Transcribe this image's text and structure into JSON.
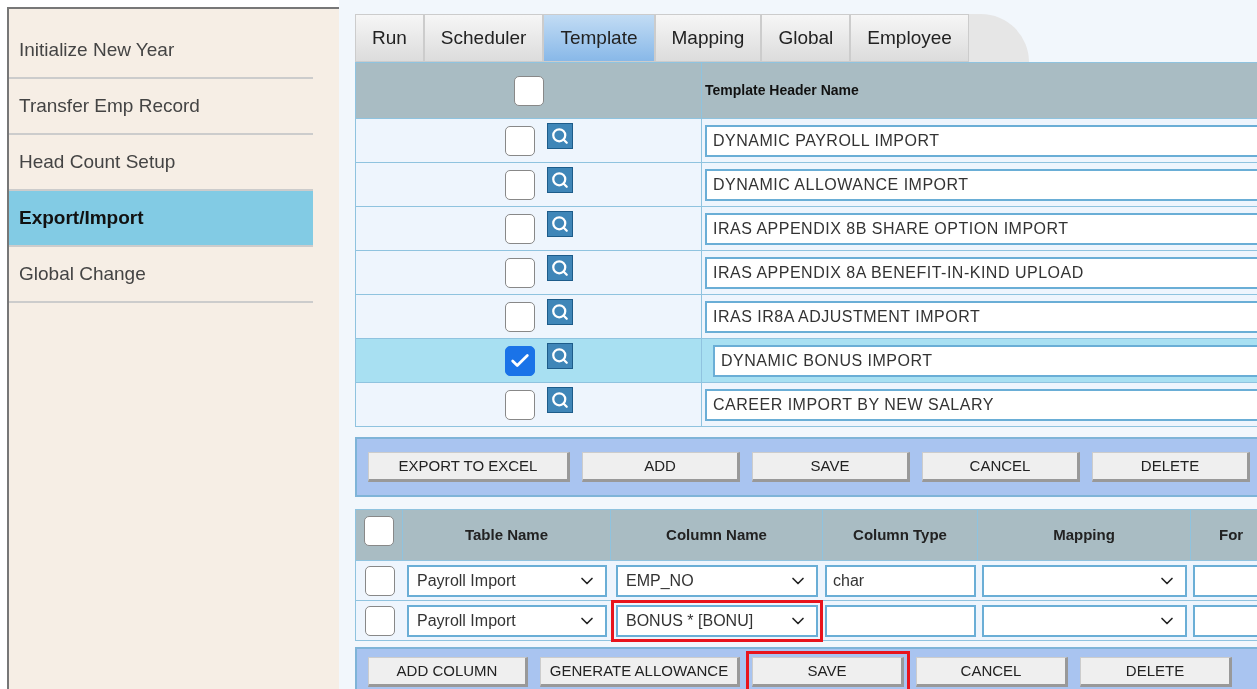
{
  "sidebar": {
    "items": [
      {
        "label": "Initialize New Year",
        "selected": false
      },
      {
        "label": "Transfer Emp Record",
        "selected": false
      },
      {
        "label": "Head Count Setup",
        "selected": false
      },
      {
        "label": "Export/Import",
        "selected": true
      },
      {
        "label": "Global Change",
        "selected": false
      }
    ]
  },
  "tabs": [
    {
      "label": "Run",
      "selected": false
    },
    {
      "label": "Scheduler",
      "selected": false
    },
    {
      "label": "Template",
      "selected": true
    },
    {
      "label": "Mapping",
      "selected": false
    },
    {
      "label": "Global",
      "selected": false
    },
    {
      "label": "Employee",
      "selected": false
    }
  ],
  "templates": {
    "header_checked": false,
    "column": "Template Header Name",
    "rows": [
      {
        "name": "DYNAMIC PAYROLL IMPORT",
        "checked": false
      },
      {
        "name": "DYNAMIC ALLOWANCE IMPORT",
        "checked": false
      },
      {
        "name": "IRAS APPENDIX 8B SHARE OPTION IMPORT",
        "checked": false
      },
      {
        "name": "IRAS APPENDIX 8A BENEFIT-IN-KIND UPLOAD",
        "checked": false
      },
      {
        "name": "IRAS IR8A ADJUSTMENT IMPORT",
        "checked": false
      },
      {
        "name": "DYNAMIC BONUS IMPORT",
        "checked": true
      },
      {
        "name": "CAREER IMPORT BY NEW SALARY",
        "checked": false
      }
    ]
  },
  "template_buttons": [
    {
      "label": "EXPORT TO EXCEL",
      "highlighted": false
    },
    {
      "label": "ADD",
      "highlighted": false
    },
    {
      "label": "SAVE",
      "highlighted": false
    },
    {
      "label": "CANCEL",
      "highlighted": false
    },
    {
      "label": "DELETE",
      "highlighted": false
    }
  ],
  "columns_table": {
    "header_checked": false,
    "columns": [
      "Table Name",
      "Column Name",
      "Column Type",
      "Mapping",
      "For"
    ],
    "rows": [
      {
        "checked": false,
        "table_name": "Payroll Import",
        "column_name": {
          "value": "EMP_NO",
          "highlighted": false
        },
        "column_type": "char"
      },
      {
        "checked": false,
        "table_name": "Payroll Import",
        "column_name": {
          "value": "BONUS * [BONU]",
          "highlighted": true
        }
      }
    ]
  },
  "column_buttons": [
    {
      "label": "ADD COLUMN",
      "highlighted": false
    },
    {
      "label": "GENERATE ALLOWANCE",
      "highlighted": false
    },
    {
      "label": "SAVE",
      "highlighted": true
    },
    {
      "label": "CANCEL",
      "highlighted": false
    },
    {
      "label": "DELETE",
      "highlighted": false
    }
  ]
}
